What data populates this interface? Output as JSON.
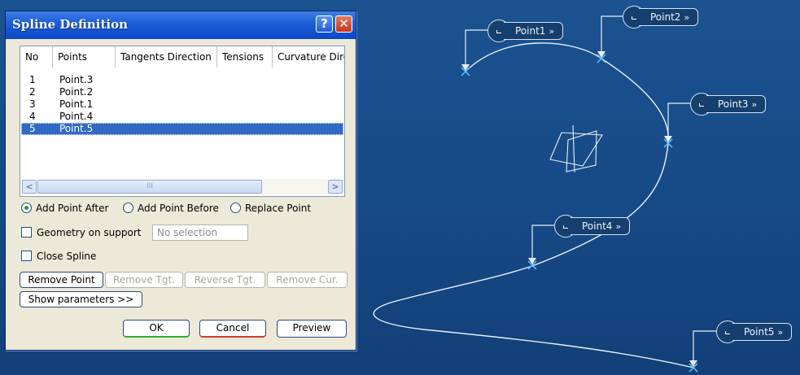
{
  "dialog": {
    "title": "Spline Definition",
    "help_glyph": "?",
    "close_glyph": "✕",
    "columns": [
      "No",
      "Points",
      "Tangents Direction",
      "Tensions",
      "Curvature Dire"
    ],
    "rows": [
      {
        "no": "1",
        "point": "Point.3"
      },
      {
        "no": "2",
        "point": "Point.2"
      },
      {
        "no": "3",
        "point": "Point.1"
      },
      {
        "no": "4",
        "point": "Point.4"
      },
      {
        "no": "5",
        "point": "Point.5",
        "selected": true
      }
    ],
    "scroll_left": "<",
    "scroll_right": ">",
    "scroll_thumb_grip": "III",
    "radio_add_after": "Add Point After",
    "radio_add_before": "Add Point Before",
    "radio_replace": "Replace Point",
    "radio_selected": "Add Point After",
    "geometry_on_support": "Geometry on support",
    "support_placeholder": "No selection",
    "close_spline": "Close Spline",
    "btn_remove_point": "Remove Point",
    "btn_remove_tgt": "Remove Tgt.",
    "btn_reverse_tgt": "Reverse Tgt.",
    "btn_remove_cur": "Remove Cur.",
    "btn_show_params": "Show parameters >>",
    "btn_ok": "OK",
    "btn_cancel": "Cancel",
    "btn_preview": "Preview"
  },
  "viewport": {
    "tags": [
      {
        "label": "Point1",
        "chevron": "»"
      },
      {
        "label": "Point2",
        "chevron": "»"
      },
      {
        "label": "Point3",
        "chevron": "»"
      },
      {
        "label": "Point4",
        "chevron": "»"
      },
      {
        "label": "Point5",
        "chevron": "»"
      }
    ]
  },
  "colors": {
    "background": "#164a86",
    "selection": "#316ac5",
    "titlebar": "#0b48c8",
    "ok_accent": "#2fb02f",
    "cancel_accent": "#d23a2a"
  }
}
